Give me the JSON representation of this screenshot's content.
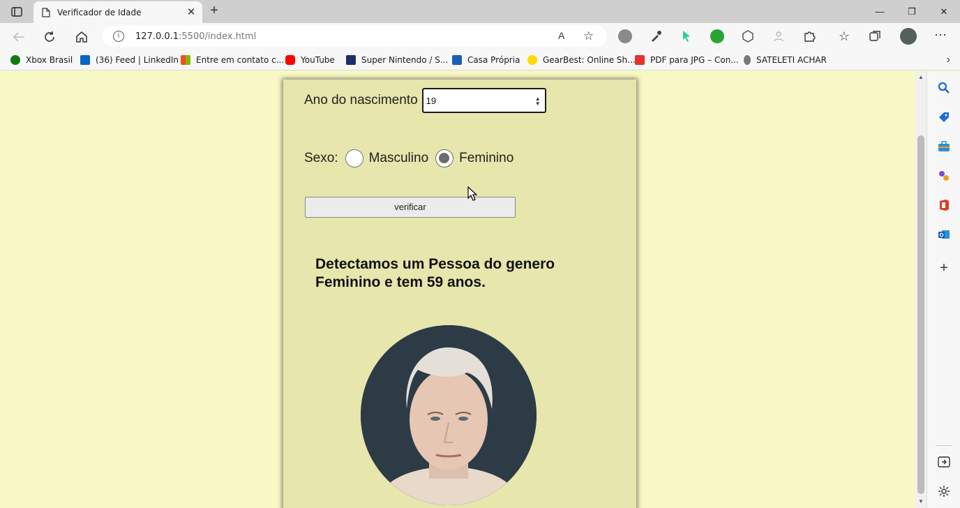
{
  "browser": {
    "tab_title": "Verificador de Idade",
    "new_tab_symbol": "+",
    "close_symbol": "✕",
    "address": {
      "host": "127.0.0.1",
      "rest": ":5500/index.html"
    },
    "read_aloud": "A",
    "window_controls": {
      "minimize": "—",
      "restore": "❐",
      "close": "✕"
    }
  },
  "bookmarks": [
    {
      "label": "Xbox Brasil",
      "icon": "xbox-icon",
      "color": "#107c10"
    },
    {
      "label": "(36) Feed | LinkedIn",
      "icon": "linkedin-icon",
      "color": "#0a66c2"
    },
    {
      "label": "Entre em contato c...",
      "icon": "microsoft-icon",
      "color": "#f25022"
    },
    {
      "label": "YouTube",
      "icon": "youtube-icon",
      "color": "#ff0000"
    },
    {
      "label": "Super Nintendo / S...",
      "icon": "fr-icon",
      "color": "#1c2f6b"
    },
    {
      "label": "Casa Própria",
      "icon": "caixa-icon",
      "color": "#1a5fb4"
    },
    {
      "label": "GearBest: Online Sh...",
      "icon": "gearbest-icon",
      "color": "#ffda00"
    },
    {
      "label": "PDF para JPG – Con...",
      "icon": "pdf-icon",
      "color": "#e5322d"
    },
    {
      "label": "SATELETI ACHAR",
      "icon": "sateleti-icon",
      "color": "#555555"
    }
  ],
  "form": {
    "ano_label": "Ano do nascimento",
    "ano_value": "19",
    "sexo_label": "Sexo:",
    "masculino_label": "Masculino",
    "feminino_label": "Feminino",
    "selected": "Feminino",
    "button_label": "verificar"
  },
  "result": {
    "text": "Detectamos um Pessoa do genero Feminino e tem 59 anos."
  },
  "colors": {
    "page_background": "#f8f8c4",
    "card_background": "#e6e6ad",
    "photo_background": "#2c3b45"
  }
}
